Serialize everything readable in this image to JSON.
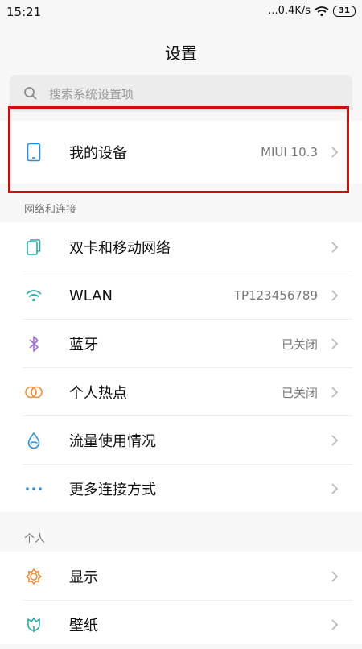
{
  "status": {
    "time": "15:21",
    "speed": "...0.4K/s",
    "battery": "31"
  },
  "header": {
    "title": "设置"
  },
  "search": {
    "placeholder": "搜索系统设置项"
  },
  "device": {
    "label": "我的设备",
    "value": "MIUI 10.3",
    "icon": "phone-icon"
  },
  "sections": {
    "network": {
      "title": "网络和连接",
      "items": [
        {
          "label": "双卡和移动网络",
          "value": "",
          "icon": "sim-card-icon",
          "color": "#2fa9a3"
        },
        {
          "label": "WLAN",
          "value": "TP123456789",
          "icon": "wifi-icon",
          "color": "#2fa9a3"
        },
        {
          "label": "蓝牙",
          "value": "已关闭",
          "icon": "bluetooth-icon",
          "color": "#9b6fd3"
        },
        {
          "label": "个人热点",
          "value": "已关闭",
          "icon": "hotspot-icon",
          "color": "#ef8a3a"
        },
        {
          "label": "流量使用情况",
          "value": "",
          "icon": "drop-icon",
          "color": "#2b8fd6"
        },
        {
          "label": "更多连接方式",
          "value": "",
          "icon": "more-dots-icon",
          "color": "#2b8fd6"
        }
      ]
    },
    "personal": {
      "title": "个人",
      "items": [
        {
          "label": "显示",
          "value": "",
          "icon": "sun-icon",
          "color": "#ef8a3a"
        },
        {
          "label": "壁纸",
          "value": "",
          "icon": "tulip-icon",
          "color": "#2fa9a3"
        }
      ]
    }
  },
  "colors": {
    "highlight": "#c81010",
    "accent": "#2fa9a3"
  }
}
